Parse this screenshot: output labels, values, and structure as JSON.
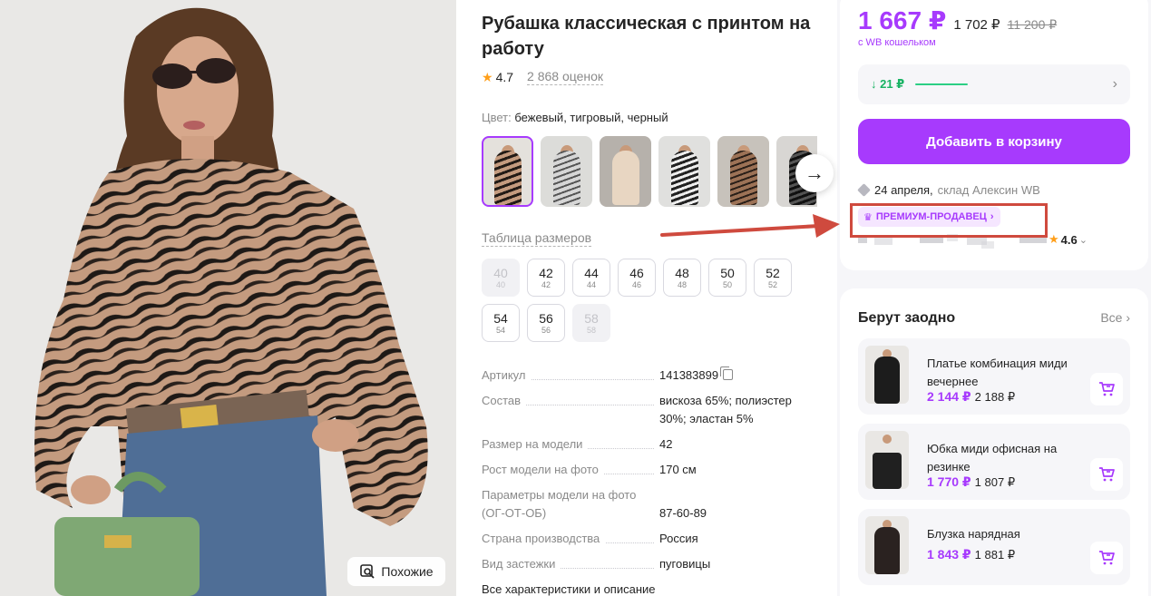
{
  "photo": {
    "similar_label": "Похожие"
  },
  "product": {
    "title": "Рубашка классическая с принтом на работу",
    "rating": "4.7",
    "reviews": "2 868 оценок",
    "color_label": "Цвет:",
    "color_value": "бежевый, тигровый, черный",
    "size_table_label": "Таблица размеров",
    "sizes": [
      {
        "ru": "40",
        "eu": "40",
        "available": false
      },
      {
        "ru": "42",
        "eu": "42",
        "available": true
      },
      {
        "ru": "44",
        "eu": "44",
        "available": true
      },
      {
        "ru": "46",
        "eu": "46",
        "available": true
      },
      {
        "ru": "48",
        "eu": "48",
        "available": true
      },
      {
        "ru": "50",
        "eu": "50",
        "available": true
      },
      {
        "ru": "52",
        "eu": "52",
        "available": true
      },
      {
        "ru": "54",
        "eu": "54",
        "available": true
      },
      {
        "ru": "56",
        "eu": "56",
        "available": true
      },
      {
        "ru": "58",
        "eu": "58",
        "available": false
      }
    ],
    "specs": [
      {
        "label": "Артикул",
        "value": "141383899"
      },
      {
        "label": "Состав",
        "value": "вискоза 65%; полиэстер",
        "value2": "30%; эластан 5%"
      },
      {
        "label": "Размер на модели",
        "value": "42"
      },
      {
        "label": "Рост модели на фото",
        "value": "170 см"
      },
      {
        "label": "Параметры модели на фото",
        "label2": "(ОГ-ОТ-ОБ)",
        "value": "87-60-89"
      },
      {
        "label": "Страна производства",
        "value": "Россия"
      },
      {
        "label": "Вид застежки",
        "value": "пуговицы"
      }
    ],
    "all_chars_label": "Все характеристики и описание"
  },
  "buy": {
    "price_main": "1 667 ₽",
    "price_secondary": "1 702 ₽",
    "price_old": "11 200 ₽",
    "wallet_note": "с WB кошельком",
    "price_drop": "↓ 21 ₽",
    "add_to_cart": "Добавить в корзину",
    "delivery_date": "24 апреля,",
    "delivery_warehouse": "склад Алексин WB",
    "premium_badge": "ПРЕМИУМ-ПРОДАВЕЦ",
    "seller_rating": "4.6"
  },
  "together": {
    "title": "Берут заодно",
    "all_label": "Все",
    "items": [
      {
        "name_line1": "Платье комбинация миди",
        "name_line2": "вечернее",
        "price": "2 144 ₽",
        "price_secondary": "2 188 ₽"
      },
      {
        "name_line1": "Юбка миди офисная на",
        "name_line2": "резинке",
        "price": "1 770 ₽",
        "price_secondary": "1 807 ₽"
      },
      {
        "name_line1": "Блузка нарядная",
        "name_line2": "",
        "price": "1 843 ₽",
        "price_secondary": "1 881 ₽"
      }
    ]
  },
  "colors": {
    "accent": "#a73afd",
    "annotation": "#cf4a3e",
    "positive": "#19b364",
    "star": "#ff9f1a"
  }
}
